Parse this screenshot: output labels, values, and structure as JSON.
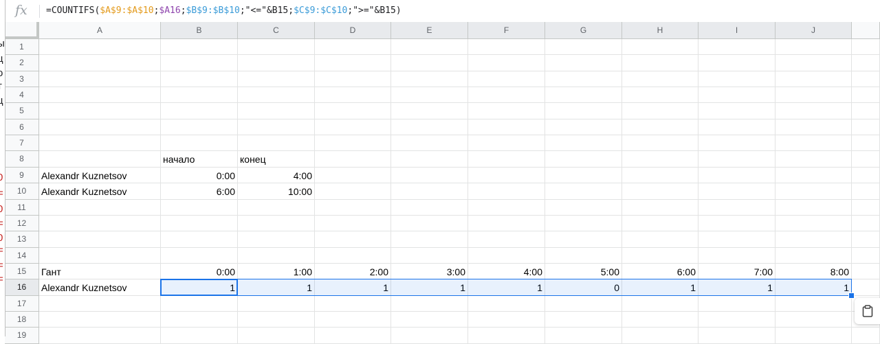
{
  "formula_bar": {
    "fx_label": "fx",
    "formula_parts": [
      {
        "text": "=COUNTIFS(",
        "color": "#202124"
      },
      {
        "text": "$A$9:$A$10",
        "color": "#e39a1b"
      },
      {
        "text": ";",
        "color": "#202124"
      },
      {
        "text": "$A16",
        "color": "#8e44ad"
      },
      {
        "text": ";",
        "color": "#202124"
      },
      {
        "text": "$B$9:$B$10",
        "color": "#3a9bd8"
      },
      {
        "text": ";\"<=\"&",
        "color": "#202124"
      },
      {
        "text": "B15",
        "color": "#202124"
      },
      {
        "text": ";",
        "color": "#202124"
      },
      {
        "text": "$C$9:$C$10",
        "color": "#3a9bd8"
      },
      {
        "text": ";\">=\"&B15)",
        "color": "#202124"
      }
    ]
  },
  "columns": [
    "A",
    "B",
    "C",
    "D",
    "E",
    "F",
    "G",
    "H",
    "I",
    "J"
  ],
  "rows": [
    1,
    2,
    3,
    4,
    5,
    6,
    7,
    8,
    9,
    10,
    11,
    12,
    13,
    14,
    15,
    16,
    17,
    18,
    19
  ],
  "cells": [
    {
      "ref": "B8",
      "value": "начало",
      "align": "left"
    },
    {
      "ref": "C8",
      "value": "конец",
      "align": "left"
    },
    {
      "ref": "A9",
      "value": "Alexandr Kuznetsov",
      "align": "left"
    },
    {
      "ref": "B9",
      "value": "0:00",
      "align": "right"
    },
    {
      "ref": "C9",
      "value": "4:00",
      "align": "right"
    },
    {
      "ref": "A10",
      "value": "Alexandr Kuznetsov",
      "align": "left"
    },
    {
      "ref": "B10",
      "value": "6:00",
      "align": "right"
    },
    {
      "ref": "C10",
      "value": "10:00",
      "align": "right"
    },
    {
      "ref": "A15",
      "value": "Гант",
      "align": "left"
    },
    {
      "ref": "B15",
      "value": "0:00",
      "align": "right"
    },
    {
      "ref": "C15",
      "value": "1:00",
      "align": "right"
    },
    {
      "ref": "D15",
      "value": "2:00",
      "align": "right"
    },
    {
      "ref": "E15",
      "value": "3:00",
      "align": "right"
    },
    {
      "ref": "F15",
      "value": "4:00",
      "align": "right"
    },
    {
      "ref": "G15",
      "value": "5:00",
      "align": "right"
    },
    {
      "ref": "H15",
      "value": "6:00",
      "align": "right"
    },
    {
      "ref": "I15",
      "value": "7:00",
      "align": "right"
    },
    {
      "ref": "J15",
      "value": "8:00",
      "align": "right"
    },
    {
      "ref": "A16",
      "value": "Alexandr Kuznetsov",
      "align": "left"
    },
    {
      "ref": "B16",
      "value": "1",
      "align": "right"
    },
    {
      "ref": "C16",
      "value": "1",
      "align": "right"
    },
    {
      "ref": "D16",
      "value": "1",
      "align": "right"
    },
    {
      "ref": "E16",
      "value": "1",
      "align": "right"
    },
    {
      "ref": "F16",
      "value": "1",
      "align": "right"
    },
    {
      "ref": "G16",
      "value": "0",
      "align": "right"
    },
    {
      "ref": "H16",
      "value": "1",
      "align": "right"
    },
    {
      "ref": "I16",
      "value": "1",
      "align": "right"
    },
    {
      "ref": "J16",
      "value": "1",
      "align": "right"
    }
  ],
  "selection": {
    "active_cell": "B16",
    "range": "B16:J16"
  },
  "left_edge_fragments": [
    {
      "text": "ы",
      "color": "#202124"
    },
    {
      "text": "ц",
      "color": "#202124"
    },
    {
      "text": "о",
      "color": "#202124"
    },
    {
      "text": "т",
      "color": "#202124"
    },
    {
      "text": "ц",
      "color": "#202124"
    },
    {
      "text": "0",
      "color": "#c5221f"
    },
    {
      "text": "=",
      "color": "#c5221f"
    },
    {
      "text": "0",
      "color": "#c5221f"
    },
    {
      "text": "=",
      "color": "#c5221f"
    },
    {
      "text": "0",
      "color": "#c5221f"
    },
    {
      "text": "=",
      "color": "#c5221f"
    },
    {
      "text": "=",
      "color": "#c5221f"
    },
    {
      "text": "=",
      "color": "#c5221f"
    }
  ],
  "icons": {
    "paste_options": "clipboard-icon"
  }
}
